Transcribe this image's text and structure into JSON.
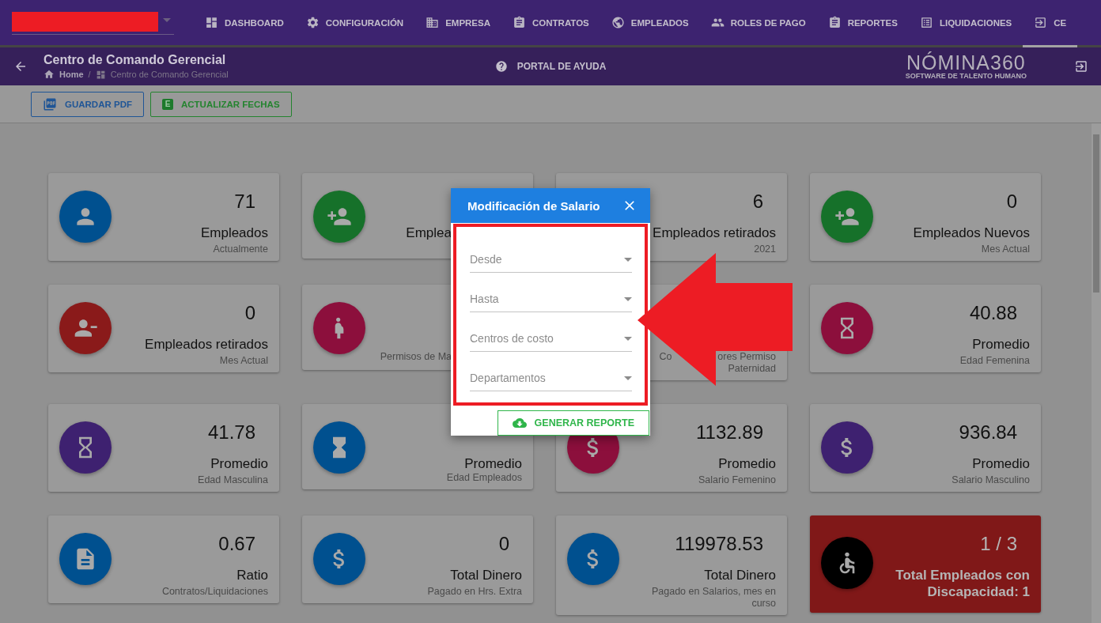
{
  "nav": {
    "tabs": [
      {
        "label": "DASHBOARD",
        "selected": false
      },
      {
        "label": "CONFIGURACIÓN",
        "selected": false
      },
      {
        "label": "EMPRESA",
        "selected": false
      },
      {
        "label": "CONTRATOS",
        "selected": false
      },
      {
        "label": "EMPLEADOS",
        "selected": false
      },
      {
        "label": "ROLES DE PAGO",
        "selected": false
      },
      {
        "label": "REPORTES",
        "selected": false
      },
      {
        "label": "LIQUIDACIONES",
        "selected": false
      },
      {
        "label": "CE",
        "selected": true
      }
    ]
  },
  "header": {
    "title": "Centro de Comando Gerencial",
    "breadcrumbs": [
      "Home",
      "Centro de Comando Gerencial"
    ],
    "breadcrumb_separator": "/",
    "help_link": "PORTAL DE AYUDA",
    "logo": {
      "name": "NÓMINA360",
      "tagline": "SOFTWARE DE TALENTO HUMANO"
    }
  },
  "toolbar": {
    "buttons": [
      {
        "label": "GUARDAR PDF",
        "kind": "pdf"
      },
      {
        "label": "ACTUALIZAR FECHAS",
        "kind": "sheet",
        "icon_letter": "E"
      }
    ]
  },
  "cards": [
    {
      "kind": "stat",
      "color": "#00508f",
      "value": "71",
      "label": "Empleados",
      "sublabel": [
        [
          "Actualmente"
        ]
      ]
    },
    {
      "kind": "stat",
      "color": "#16712a",
      "label": "Emplea"
    },
    {
      "kind": "stat",
      "value": "6",
      "label": "Empleados retirados",
      "sublabel": [
        [
          "2021"
        ]
      ]
    },
    {
      "kind": "stat",
      "color": "#16712a",
      "value": "0",
      "label": "Empleados Nuevos",
      "sublabel": [
        [
          "Mes Actual"
        ]
      ]
    },
    {
      "kind": "stat",
      "color": "#8a1a1a",
      "value": "0",
      "label": "Empleados retirados",
      "sublabel": [
        [
          "Mes Actual"
        ]
      ]
    },
    {
      "kind": "stat",
      "color": "#8c0f3c",
      "sublabel": [
        [
          "Permisos de Ma"
        ]
      ]
    },
    {
      "kind": "stat",
      "sublabel": [
        [
          "Co",
          "ores Permiso"
        ],
        [
          "Paternidad"
        ]
      ]
    },
    {
      "kind": "stat",
      "color": "#8c0f3c",
      "value": "40.88",
      "label": "Promedio",
      "sublabel": [
        [
          "Edad Femenina"
        ]
      ]
    },
    {
      "kind": "stat",
      "color": "#3e2170",
      "value": "41.78",
      "label": "Promedio",
      "sublabel": [
        [
          "Edad Masculina"
        ]
      ]
    },
    {
      "kind": "stat",
      "color": "#00508f",
      "label": "Promedio",
      "sublabel": [
        [
          "Edad Empleados"
        ]
      ]
    },
    {
      "kind": "stat",
      "color": "#8c0f3c",
      "value": "1132.89",
      "label": "Promedio",
      "sublabel": [
        [
          "Salario Femenino"
        ]
      ]
    },
    {
      "kind": "stat",
      "color": "#3e2170",
      "value": "936.84",
      "label": "Promedio",
      "sublabel": [
        [
          "Salario Masculino"
        ]
      ]
    },
    {
      "kind": "stat",
      "color": "#00508f",
      "value": "0.67",
      "label": "Ratio",
      "sublabel": [
        [
          "Contratos/Liquidaciones"
        ]
      ]
    },
    {
      "kind": "stat",
      "color": "#00508f",
      "value": "0",
      "label": "Total Dinero",
      "sublabel": [
        [
          "Pagado en Hrs. Extra"
        ]
      ]
    },
    {
      "kind": "stat",
      "color": "#00508f",
      "value": "119978.53",
      "label": "Total Dinero",
      "sublabel": [
        [
          "Pagado en Salarios, mes en curso"
        ]
      ]
    },
    {
      "kind": "alert",
      "color": "#000000",
      "value": "1 / 3",
      "label": "Total Empleados con Discapacidad: 1"
    }
  ],
  "dialog": {
    "title": "Modificación de Salario",
    "fields": [
      {
        "placeholder": "Desde"
      },
      {
        "placeholder": "Hasta"
      },
      {
        "placeholder": "Centros de costo"
      },
      {
        "placeholder": "Departamentos"
      }
    ],
    "button": "GENERAR REPORTE"
  }
}
